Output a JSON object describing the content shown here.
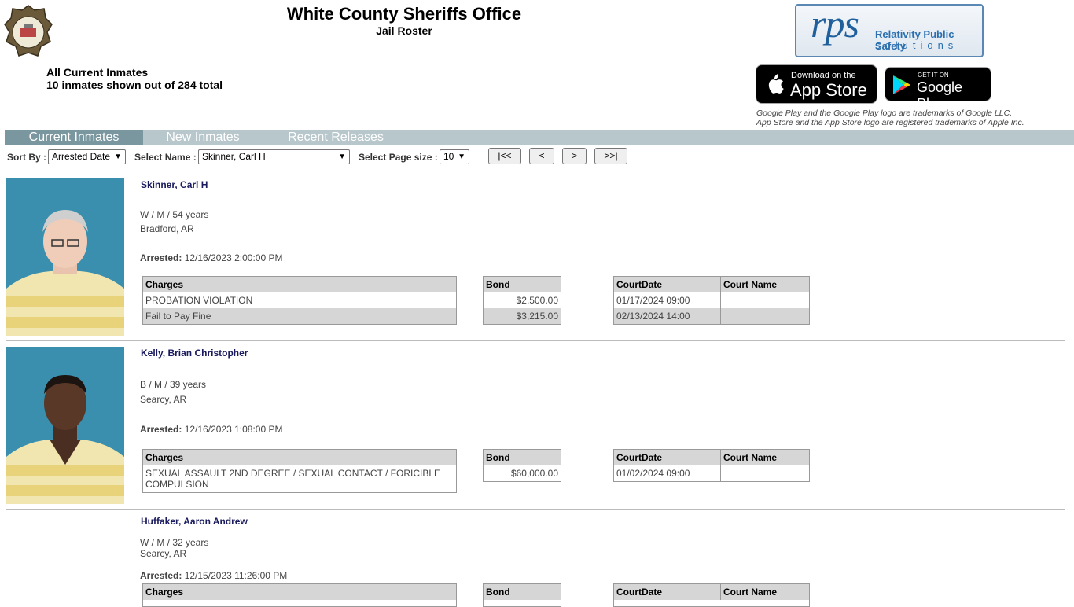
{
  "header": {
    "title": "White County Sheriffs Office",
    "subtitle": "Jail Roster",
    "badge_text": "SHERIFF WHITE COUNTY",
    "summary_line1": "All Current Inmates",
    "summary_line2": "10 inmates shown out of 284 total"
  },
  "vendor": {
    "logo_main": "rps",
    "logo_line1": "Relativity Public Safety",
    "logo_line2": "solutions"
  },
  "stores": {
    "appstore_small": "Download on the",
    "appstore_big": "App Store",
    "googleplay_small": "GET IT ON",
    "googleplay_big": "Google Play",
    "disclaimer1": "Google Play and the Google Play logo are trademarks of Google LLC.",
    "disclaimer2": "App Store and the App Store logo are registered trademarks of Apple Inc."
  },
  "tabs": [
    {
      "label": "Current Inmates",
      "active": true
    },
    {
      "label": "New Inmates",
      "active": false
    },
    {
      "label": "Recent Releases",
      "active": false
    }
  ],
  "controls": {
    "sort_label": "Sort By :",
    "sort_value": "Arrested Date",
    "name_label": "Select Name :",
    "name_value": "Skinner, Carl H",
    "pagesize_label": "Select Page size :",
    "pagesize_value": "10",
    "first": "|<<",
    "prev": "<",
    "next": ">",
    "last": ">>|"
  },
  "table_headers": {
    "charges": "Charges",
    "bond": "Bond",
    "courtdate": "CourtDate",
    "courtname": "Court Name"
  },
  "arrested_label": "Arrested:",
  "inmates": [
    {
      "name": "Skinner, Carl H",
      "demographics": "W / M / 54 years",
      "location": "Bradford, AR",
      "arrested": "12/16/2023 2:00:00 PM",
      "charges": [
        "PROBATION VIOLATION",
        "Fail to Pay Fine"
      ],
      "bonds": [
        "$2,500.00",
        "$3,215.00"
      ],
      "court_dates": [
        "01/17/2024 09:00",
        "02/13/2024 14:00"
      ]
    },
    {
      "name": "Kelly, Brian Christopher",
      "demographics": "B / M / 39 years",
      "location": "Searcy, AR",
      "arrested": "12/16/2023 1:08:00 PM",
      "charges": [
        "SEXUAL ASSAULT 2ND DEGREE / SEXUAL CONTACT / FORICIBLE COMPULSION"
      ],
      "bonds": [
        "$60,000.00"
      ],
      "court_dates": [
        "01/02/2024 09:00"
      ]
    },
    {
      "name": "Huffaker, Aaron Andrew",
      "demographics": "W / M / 32 years",
      "location": "Searcy, AR",
      "arrested": "12/15/2023 11:26:00 PM"
    }
  ]
}
